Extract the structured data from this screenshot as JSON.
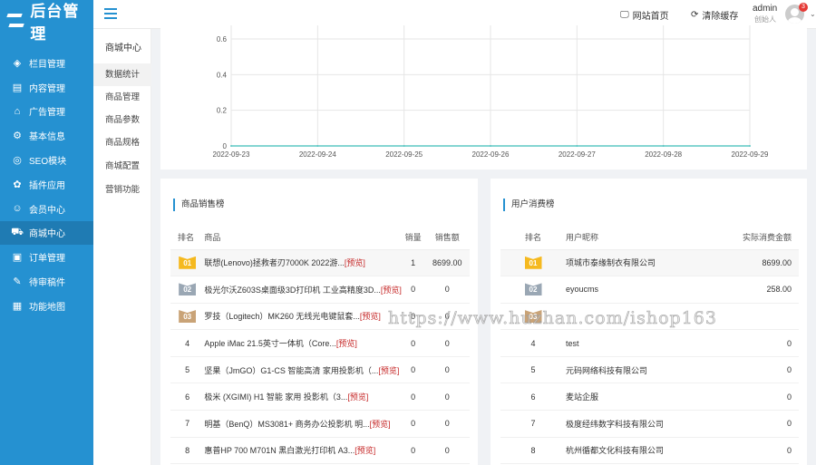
{
  "app": {
    "logo_text": "后台管理"
  },
  "sidebar": {
    "items": [
      {
        "label": "栏目管理",
        "icon": "layers-icon",
        "glyph": "◈"
      },
      {
        "label": "内容管理",
        "icon": "document-icon",
        "glyph": "▤"
      },
      {
        "label": "广告管理",
        "icon": "home-icon",
        "glyph": "⌂"
      },
      {
        "label": "基本信息",
        "icon": "gear-icon",
        "glyph": "⚙"
      },
      {
        "label": "SEO模块",
        "icon": "seo-icon",
        "glyph": "◎"
      },
      {
        "label": "插件应用",
        "icon": "plugin-icon",
        "glyph": "✿"
      },
      {
        "label": "会员中心",
        "icon": "user-icon",
        "glyph": "☺"
      },
      {
        "label": "商城中心",
        "icon": "cart-icon",
        "glyph": "⛟"
      },
      {
        "label": "订单管理",
        "icon": "order-icon",
        "glyph": "▣"
      },
      {
        "label": "待审稿件",
        "icon": "review-icon",
        "glyph": "✎"
      },
      {
        "label": "功能地图",
        "icon": "grid-icon",
        "glyph": "▦"
      }
    ],
    "active_index": 7
  },
  "submenu": {
    "title": "商城中心",
    "items": [
      "数据统计",
      "商品管理",
      "商品参数",
      "商品规格",
      "商城配置",
      "营销功能"
    ],
    "active_index": 0
  },
  "topbar": {
    "site_home": "网站首页",
    "clear_cache": "清除缓存",
    "user_name": "admin",
    "user_role": "创始人",
    "badge_count": "3"
  },
  "chart_data": {
    "type": "line",
    "x": [
      "2022-09-23",
      "2022-09-24",
      "2022-09-25",
      "2022-09-26",
      "2022-09-27",
      "2022-09-28",
      "2022-09-29"
    ],
    "y_ticks": [
      "0.6",
      "0.4",
      "0.2",
      "0"
    ],
    "series": [
      {
        "values": [
          0,
          0,
          0,
          0,
          0,
          0,
          0
        ],
        "color": "#5cc7c4"
      }
    ],
    "ylim": [
      0,
      0.6
    ],
    "grid": true
  },
  "sales_rank": {
    "title": "商品销售榜",
    "headers": [
      "排名",
      "商品",
      "销量",
      "销售额"
    ],
    "preview_label": "[预览]",
    "rows": [
      {
        "rank": "01",
        "name": "联想(Lenovo)拯救者刃7000K 2022游...",
        "sales": "1",
        "amount": "8699.00"
      },
      {
        "rank": "02",
        "name": "极光尔沃Z603S桌面级3D打印机 工业高精度3D...",
        "sales": "0",
        "amount": "0"
      },
      {
        "rank": "03",
        "name": "罗技（Logitech）MK260 无线光电键鼠套...",
        "sales": "0",
        "amount": "0"
      },
      {
        "rank": "4",
        "name": "Apple iMac 21.5英寸一体机（Core...",
        "sales": "0",
        "amount": "0"
      },
      {
        "rank": "5",
        "name": "坚果（JmGO）G1-CS 智能高清 家用投影机（...",
        "sales": "0",
        "amount": "0"
      },
      {
        "rank": "6",
        "name": "极米 (XGIMI) H1 智能 家用 投影机（3...",
        "sales": "0",
        "amount": "0"
      },
      {
        "rank": "7",
        "name": "明基（BenQ）MS3081+ 商务办公投影机 明...",
        "sales": "0",
        "amount": "0"
      },
      {
        "rank": "8",
        "name": "惠普HP 700 M701N 黑白激光打印机 A3...",
        "sales": "0",
        "amount": "0"
      }
    ]
  },
  "consume_rank": {
    "title": "用户消费榜",
    "headers": [
      "排名",
      "用户昵称",
      "实际消费金额"
    ],
    "rows": [
      {
        "rank": "01",
        "name": "项城市泰缘制衣有限公司",
        "amount": "8699.00"
      },
      {
        "rank": "02",
        "name": "eyoucms",
        "amount": "258.00"
      },
      {
        "rank": "03",
        "name": "",
        "amount": ""
      },
      {
        "rank": "4",
        "name": "test",
        "amount": "0"
      },
      {
        "rank": "5",
        "name": "元码网络科技有限公司",
        "amount": "0"
      },
      {
        "rank": "6",
        "name": "麦站企服",
        "amount": "0"
      },
      {
        "rank": "7",
        "name": "极度经纬数字科技有限公司",
        "amount": "0"
      },
      {
        "rank": "8",
        "name": "杭州循都文化科技有限公司",
        "amount": "0"
      }
    ]
  },
  "watermark": "https://www.huzhan.com/ishop163"
}
